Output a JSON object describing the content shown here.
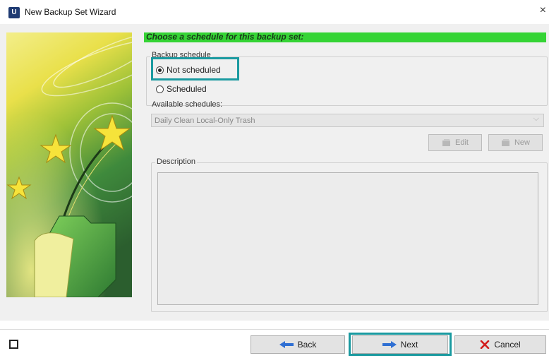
{
  "window": {
    "app_icon_letter": "U",
    "title": "New Backup Set Wizard",
    "close_glyph": "×"
  },
  "page": {
    "heading": "Choose a schedule for this backup set:",
    "backup_schedule_group": {
      "legend": "Backup schedule",
      "options": [
        {
          "label": "Not scheduled",
          "selected": true,
          "highlighted": true
        },
        {
          "label": "Scheduled",
          "selected": false
        }
      ]
    },
    "available_schedules": {
      "label": "Available schedules:",
      "selected": "Daily Clean Local-Only Trash",
      "enabled": false
    },
    "buttons": {
      "edit": "Edit",
      "new": "New"
    },
    "description": {
      "legend": "Description",
      "text": ""
    }
  },
  "footer": {
    "back": "Back",
    "next": "Next",
    "cancel": "Cancel"
  },
  "colors": {
    "header_bar": "#35d435",
    "highlight": "#1a9aa0",
    "cancel_x": "#d21c1c",
    "arrow_blue": "#2f6fd3"
  },
  "icons": {
    "wizard_art": "wizard-stars-folder-art",
    "edit": "edit-icon",
    "new": "new-icon",
    "back": "back-arrow-icon",
    "next": "next-arrow-icon",
    "cancel": "cancel-x-icon"
  }
}
